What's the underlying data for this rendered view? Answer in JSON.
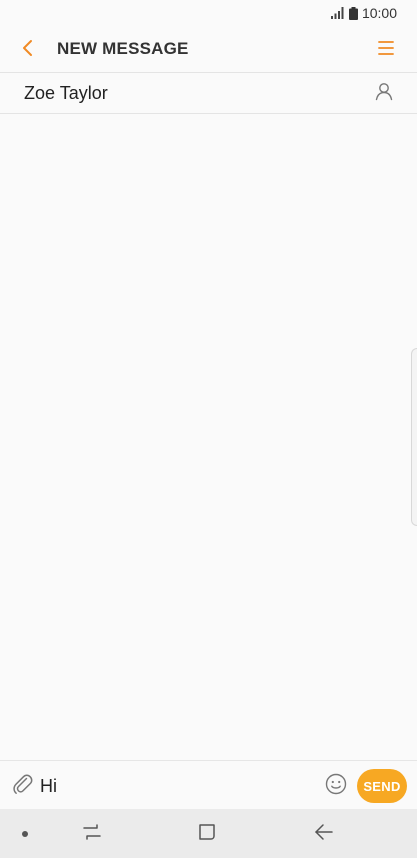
{
  "status_bar": {
    "time": "10:00",
    "icons": [
      "signal-icon",
      "battery-icon"
    ]
  },
  "app_bar": {
    "title": "NEW MESSAGE",
    "back_icon": "chevron-left-icon",
    "menu_icon": "menu-icon"
  },
  "recipient": {
    "name": "Zoe Taylor",
    "contact_icon": "contact-icon"
  },
  "composer": {
    "attach_icon": "paperclip-icon",
    "message_value": "Hi",
    "emoji_icon": "emoji-icon",
    "send_label": "SEND"
  },
  "navigation_bar": {
    "icons": [
      "dot-icon",
      "recent-apps-icon",
      "home-icon",
      "back-icon"
    ]
  },
  "colors": {
    "accent": "#f08a24",
    "send_button": "#f7a823",
    "background": "#fafafa",
    "nav_bar": "#ebebeb"
  }
}
